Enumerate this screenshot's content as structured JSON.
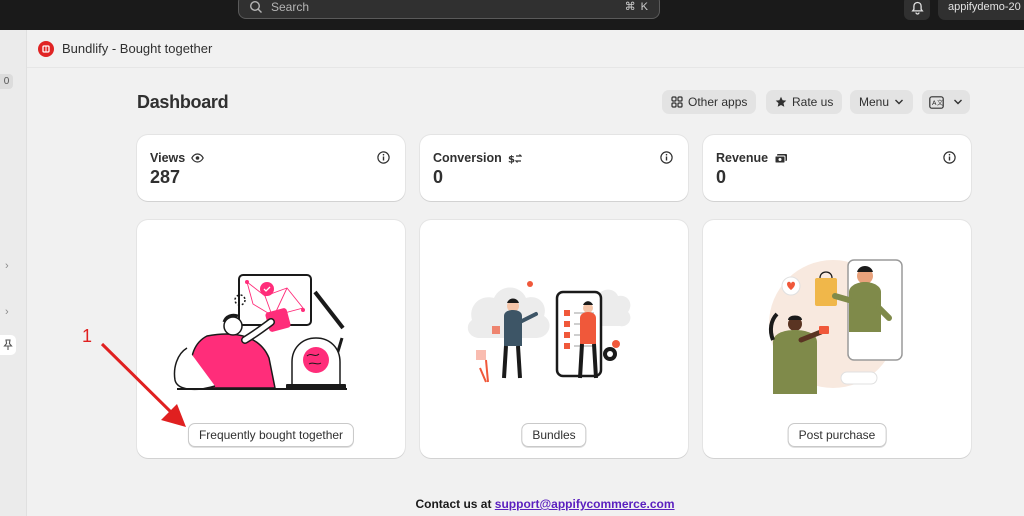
{
  "topbar": {
    "search_placeholder": "Search",
    "search_shortcut": "⌘ K",
    "store_name": "appifydemo-20"
  },
  "sidebar": {
    "badge": "0"
  },
  "app": {
    "title": "Bundlify - Bought together"
  },
  "page": {
    "title": "Dashboard",
    "buttons": {
      "other_apps": "Other apps",
      "rate_us": "Rate us",
      "menu": "Menu"
    }
  },
  "stats": [
    {
      "label": "Views",
      "value": "287",
      "icon": "eye-icon"
    },
    {
      "label": "Conversion",
      "value": "0",
      "icon": "dollar-swap-icon"
    },
    {
      "label": "Revenue",
      "value": "0",
      "icon": "cash-icon"
    }
  ],
  "features": [
    {
      "button": "Frequently bought together"
    },
    {
      "button": "Bundles"
    },
    {
      "button": "Post purchase"
    }
  ],
  "annotation": {
    "number": "1",
    "color": "#e02020"
  },
  "footer": {
    "prefix": "Contact us at ",
    "email": "support@appifycommerce.com"
  },
  "colors": {
    "accent_pink": "#ff2d7a",
    "accent_orange": "#f0583a",
    "brand_red": "#e02424"
  }
}
